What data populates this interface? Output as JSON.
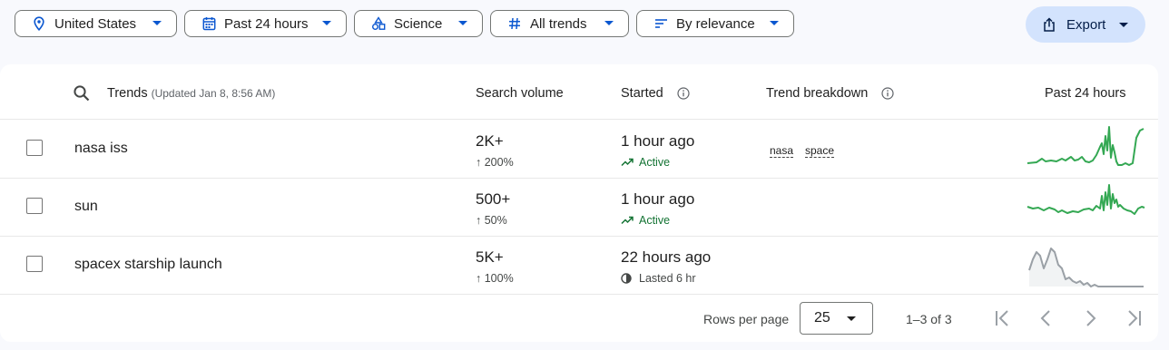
{
  "filters": {
    "location": "United States",
    "time_range": "Past 24 hours",
    "category": "Science",
    "trend_type": "All trends",
    "sort": "By relevance"
  },
  "export_label": "Export",
  "table": {
    "headers": {
      "trends": "Trends",
      "updated": "(Updated Jan 8, 8:56 AM)",
      "search_volume": "Search volume",
      "started": "Started",
      "breakdown": "Trend breakdown",
      "chart": "Past 24 hours"
    },
    "rows": [
      {
        "term": "nasa iss",
        "volume": "2K+",
        "change": "↑ 200%",
        "started": "1 hour ago",
        "status": "Active",
        "status_type": "active",
        "breakdown": [
          "nasa",
          "space"
        ],
        "spark_color": "#34a853"
      },
      {
        "term": "sun",
        "volume": "500+",
        "change": "↑ 50%",
        "started": "1 hour ago",
        "status": "Active",
        "status_type": "active",
        "breakdown": [],
        "spark_color": "#34a853"
      },
      {
        "term": "spacex starship launch",
        "volume": "5K+",
        "change": "↑ 100%",
        "started": "22 hours ago",
        "status": "Lasted 6 hr",
        "status_type": "ended",
        "breakdown": [],
        "spark_color": "#9aa0a6"
      }
    ]
  },
  "pagination": {
    "rows_per_page_label": "Rows per page",
    "rows_per_page": "25",
    "range": "1–3 of 3"
  },
  "colors": {
    "accent": "#0b57d0",
    "active": "#137333",
    "export_bg": "#d3e3fd"
  }
}
